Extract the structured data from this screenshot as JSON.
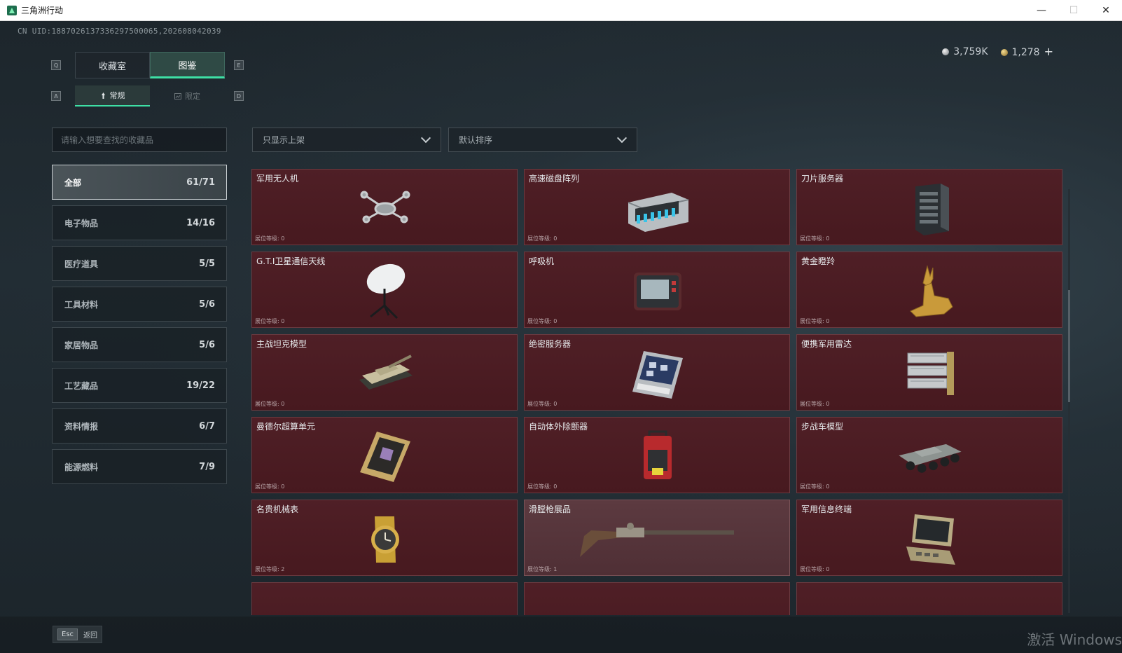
{
  "window": {
    "title": "三角洲行动"
  },
  "header": {
    "uid": "CN UID:1887026137336297500065,202608042039",
    "currency_silver": "3,759K",
    "currency_gold": "1,278"
  },
  "key_hints": {
    "main_prev": "Q",
    "main_next": "E",
    "sub_prev": "A",
    "sub_next": "D"
  },
  "main_tabs": [
    {
      "label": "收藏室"
    },
    {
      "label": "图鉴"
    }
  ],
  "sub_tabs": [
    {
      "label": "常规"
    },
    {
      "label": "限定"
    }
  ],
  "search": {
    "placeholder": "请输入想要查找的收藏品"
  },
  "filters": {
    "shelf": "只显示上架",
    "sort": "默认排序"
  },
  "categories": [
    {
      "label": "全部",
      "count": "61/71"
    },
    {
      "label": "电子物品",
      "count": "14/16"
    },
    {
      "label": "医疗道具",
      "count": "5/5"
    },
    {
      "label": "工具材料",
      "count": "5/6"
    },
    {
      "label": "家居物品",
      "count": "5/6"
    },
    {
      "label": "工艺藏品",
      "count": "19/22"
    },
    {
      "label": "资料情报",
      "count": "6/7"
    },
    {
      "label": "能源燃料",
      "count": "7/9"
    }
  ],
  "items": [
    {
      "name": "军用无人机",
      "level": "展位等级: 0",
      "icon": "drone-icon"
    },
    {
      "name": "高速磁盘阵列",
      "level": "展位等级: 0",
      "icon": "disk-array-icon"
    },
    {
      "name": "刀片服务器",
      "level": "展位等级: 0",
      "icon": "blade-server-icon"
    },
    {
      "name": "G.T.I卫星通信天线",
      "level": "展位等级: 0",
      "icon": "satellite-dish-icon"
    },
    {
      "name": "呼吸机",
      "level": "展位等级: 0",
      "icon": "ventilator-icon"
    },
    {
      "name": "黄金瞪羚",
      "level": "展位等级: 0",
      "icon": "gold-gazelle-icon"
    },
    {
      "name": "主战坦克模型",
      "level": "展位等级: 0",
      "icon": "tank-model-icon"
    },
    {
      "name": "绝密服务器",
      "level": "展位等级: 0",
      "icon": "secret-server-icon"
    },
    {
      "name": "便携军用雷达",
      "level": "展位等级: 0",
      "icon": "radar-icon"
    },
    {
      "name": "曼德尔超算单元",
      "level": "展位等级: 0",
      "icon": "supercomputer-unit-icon"
    },
    {
      "name": "自动体外除颤器",
      "level": "展位等级: 0",
      "icon": "defibrillator-icon"
    },
    {
      "name": "步战车模型",
      "level": "展位等级: 0",
      "icon": "ifv-model-icon"
    },
    {
      "name": "名贵机械表",
      "level": "展位等级: 2",
      "icon": "watch-icon"
    },
    {
      "name": "滑膛枪展品",
      "level": "展位等级: 1",
      "icon": "musket-icon"
    },
    {
      "name": "军用信息终端",
      "level": "展位等级: 0",
      "icon": "info-terminal-icon"
    },
    {
      "name": "",
      "level": "",
      "icon": "partial-item-icon"
    },
    {
      "name": "",
      "level": "",
      "icon": "partial-item-icon"
    },
    {
      "name": "",
      "level": "",
      "icon": "partial-item-icon"
    }
  ],
  "footer": {
    "esc_key": "Esc",
    "esc_label": "返回"
  },
  "watermark": "激活 Windows",
  "colors": {
    "accent": "#3ee0a5",
    "card_bg": "#4f1f26",
    "card_highlight": "#5c3a40"
  }
}
